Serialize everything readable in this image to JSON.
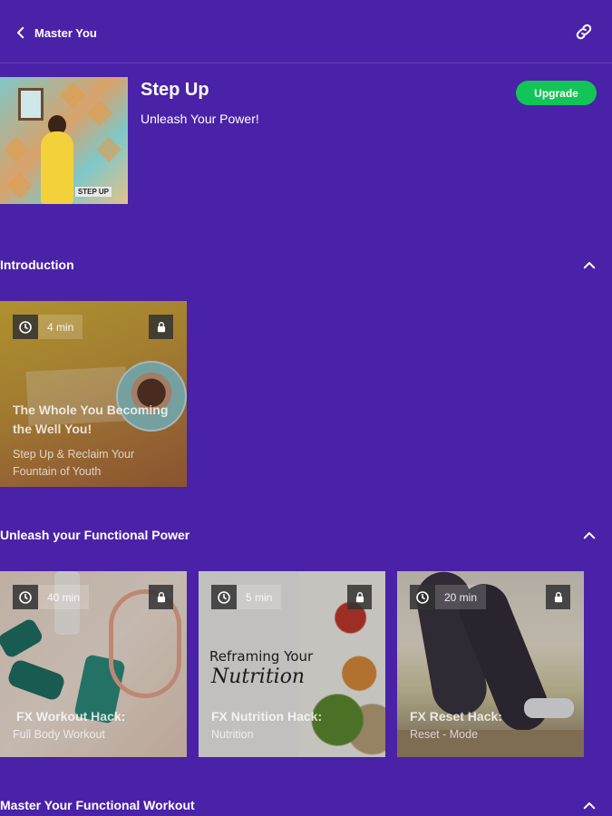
{
  "header": {
    "title": "Master You",
    "back_icon": "chevron-left-icon",
    "share_icon": "link-icon"
  },
  "program": {
    "title": "Step Up",
    "subtitle": "Unleash Your Power!",
    "upgrade_label": "Upgrade",
    "thumb_sign": "STEP UP"
  },
  "sections": [
    {
      "title": "Introduction",
      "cards": [
        {
          "duration": "4 min",
          "title": "The Whole You Becoming the Well You!",
          "subtitle": "Step Up & Reclaim Your Fountain of Youth"
        }
      ]
    },
    {
      "title": "Unleash your Functional Power",
      "cards": [
        {
          "duration": "40 min",
          "title": "FX Workout Hack:",
          "subtitle": "Full Body Workout"
        },
        {
          "duration": "5 min",
          "title": "FX Nutrition Hack:",
          "subtitle": "Nutrition",
          "overlay_text": "Reframing Your",
          "overlay_script": "Nutrition"
        },
        {
          "duration": "20 min",
          "title": "FX Reset Hack:",
          "subtitle": "Reset - Mode"
        }
      ]
    },
    {
      "title": "Master Your Functional Workout"
    }
  ],
  "colors": {
    "background": "#4a22a8",
    "upgrade": "#13c456"
  }
}
